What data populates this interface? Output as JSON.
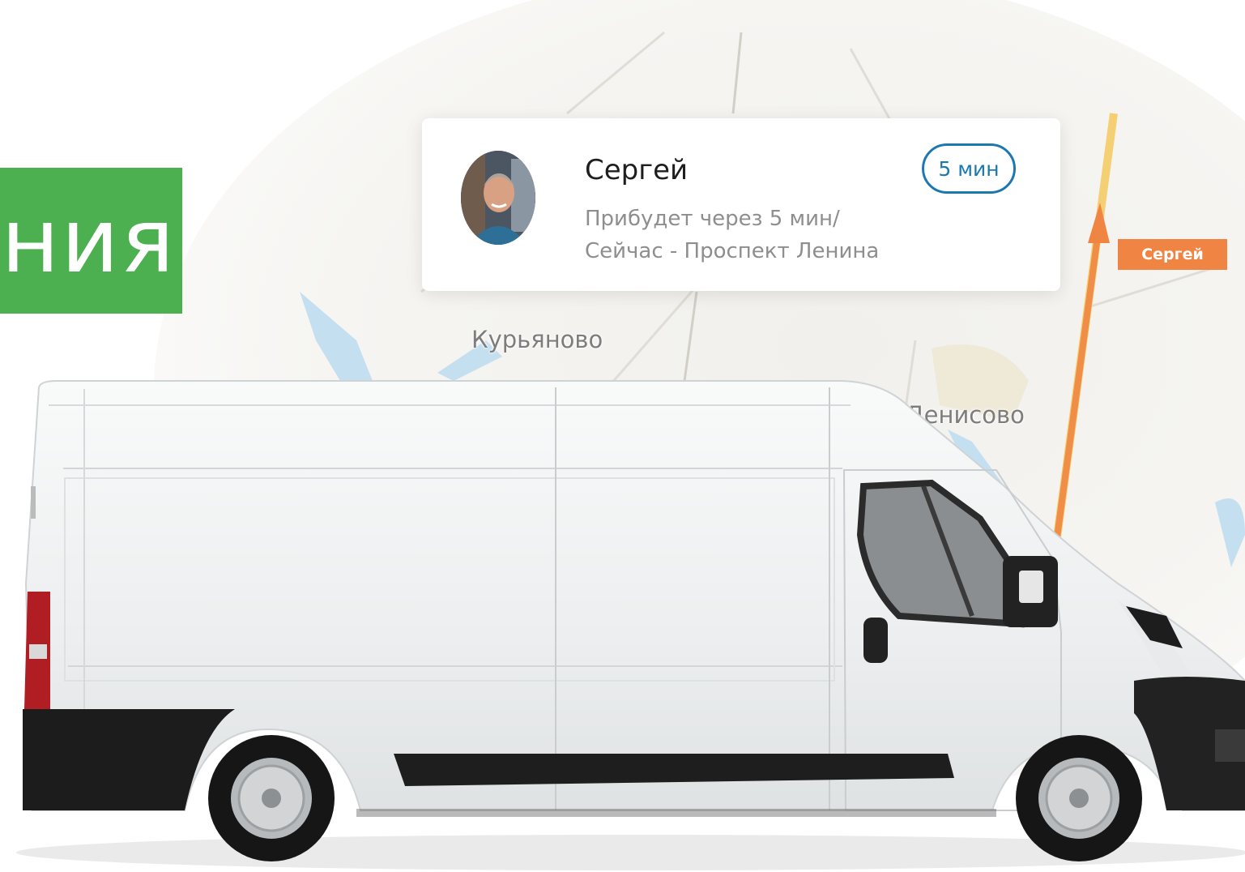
{
  "banner": {
    "text": "ния",
    "color": "#4caf50"
  },
  "driver_card": {
    "name": "Сергей",
    "status_line1": "Прибудет через 5 мин/",
    "status_line2": "Сейчас - Проспект Ленина",
    "eta_badge": "5 мин",
    "accent_color": "#1b79b0"
  },
  "map": {
    "pin_label": "Сергей",
    "pin_color": "#f08543",
    "places": [
      "Курьяново",
      "Денисово"
    ]
  },
  "icons": [
    "avatar-photo",
    "route-arrow-icon",
    "delivery-van-illustration"
  ]
}
